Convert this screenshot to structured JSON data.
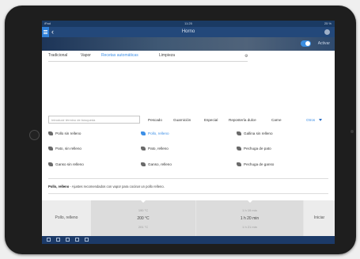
{
  "status_bar": {
    "left": "iPad",
    "time": "11:25",
    "battery": "25 %"
  },
  "nav": {
    "title": "Horno",
    "back_icon": "chevron-left-icon",
    "menu_icon": "menu-icon",
    "settings_icon": "gear-icon"
  },
  "banner": {
    "toggle_label": "Activar",
    "toggle_on": true
  },
  "tabs": [
    {
      "label": "Tradicional",
      "active": false
    },
    {
      "label": "Vapor",
      "active": false
    },
    {
      "label": "Recetas automáticas",
      "active": true
    },
    {
      "label": "Limpieza",
      "active": false
    }
  ],
  "search": {
    "placeholder": "Introducir término de búsqueda"
  },
  "categories": [
    "Pescado",
    "Guarnición",
    "Especial",
    "Repostería dulce",
    "Carne"
  ],
  "more_label": "Otros",
  "recipes": [
    {
      "label": "Pollo sin relleno",
      "selected": false
    },
    {
      "label": "Pollo, relleno",
      "selected": true
    },
    {
      "label": "Gallina sin relleno",
      "selected": false
    },
    {
      "label": "Pato, sin relleno",
      "selected": false
    },
    {
      "label": "Pato, relleno",
      "selected": false
    },
    {
      "label": "Pechuga de pato",
      "selected": false
    },
    {
      "label": "Ganso sin relleno",
      "selected": false
    },
    {
      "label": "Ganso, relleno",
      "selected": false
    },
    {
      "label": "Pechuga de ganso",
      "selected": false
    }
  ],
  "description": {
    "title": "Pollo, relleno",
    "text": " - Ajustes recomendados con vapor para cocinar un pollo relleno."
  },
  "settings": {
    "recipe_name": "Pollo, relleno",
    "temperature": {
      "above": "190 °C",
      "value": "200 °C",
      "below": "201 °C"
    },
    "duration": {
      "above": "1 h 19 min",
      "value": "1 h 20 min",
      "below": "1 h 21 min"
    },
    "start_label": "Iniciar"
  },
  "colors": {
    "accent": "#3d8fe6",
    "navbar": "#23487a",
    "toolbar": "#1c3a68"
  }
}
